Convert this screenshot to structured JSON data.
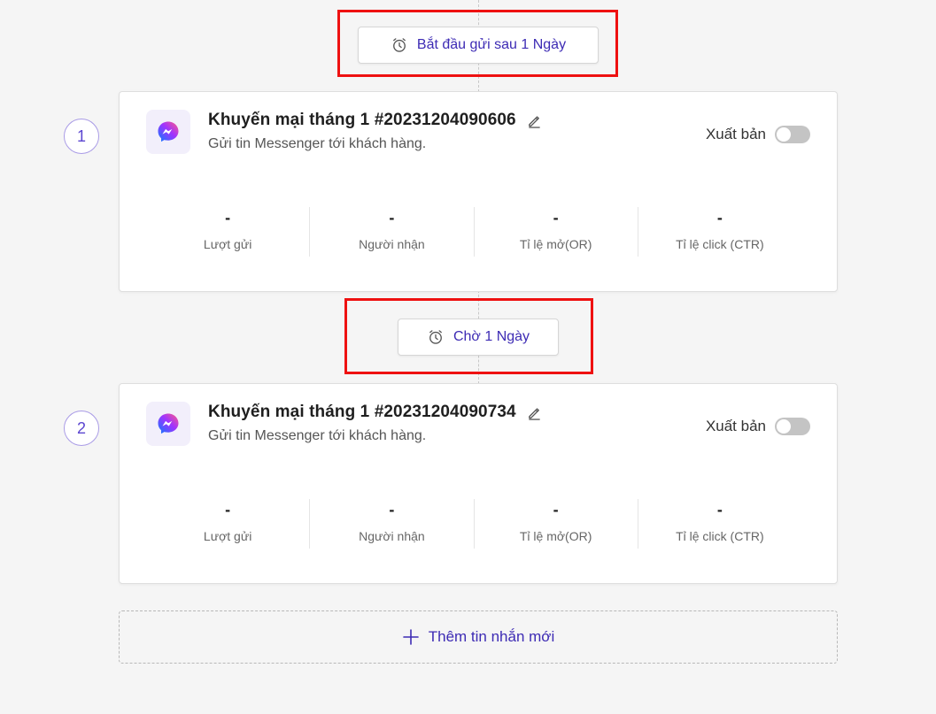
{
  "delays": [
    {
      "label": "Bắt đầu gửi sau 1 Ngày",
      "icon": "alarm-clock-icon"
    },
    {
      "label": "Chờ 1 Ngày",
      "icon": "alarm-clock-icon"
    }
  ],
  "messages": [
    {
      "step": "1",
      "title": "Khuyến mại tháng 1 #20231204090606",
      "subtitle": "Gửi tin Messenger tới khách hàng.",
      "channel_icon": "messenger-icon",
      "publish_label": "Xuất bản",
      "published": false,
      "stats": [
        {
          "value": "-",
          "label": "Lượt gửi"
        },
        {
          "value": "-",
          "label": "Người nhận"
        },
        {
          "value": "-",
          "label": "Tỉ lệ mở(OR)"
        },
        {
          "value": "-",
          "label": "Tỉ lệ click (CTR)"
        }
      ]
    },
    {
      "step": "2",
      "title": "Khuyến mại tháng 1 #20231204090734",
      "subtitle": "Gửi tin Messenger tới khách hàng.",
      "channel_icon": "messenger-icon",
      "publish_label": "Xuất bản",
      "published": false,
      "stats": [
        {
          "value": "-",
          "label": "Lượt gửi"
        },
        {
          "value": "-",
          "label": "Người nhận"
        },
        {
          "value": "-",
          "label": "Tỉ lệ mở(OR)"
        },
        {
          "value": "-",
          "label": "Tỉ lệ click (CTR)"
        }
      ]
    }
  ],
  "add_message": {
    "label": "Thêm tin nhắn mới",
    "icon": "plus-icon"
  },
  "colors": {
    "accent": "#3d2bb4",
    "highlight": "#ee1111",
    "toggle_off": "#c4c4c4",
    "background": "#f5f5f5"
  }
}
